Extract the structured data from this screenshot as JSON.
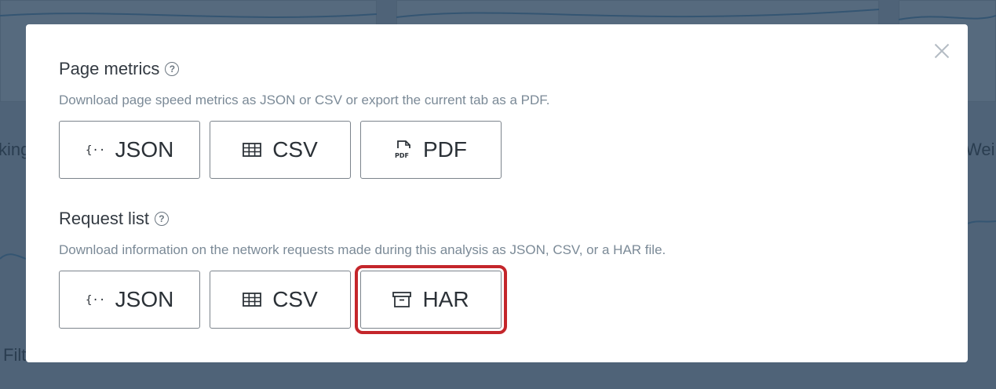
{
  "background": {
    "left_text": "king",
    "right_text": "Wei",
    "bottom_text": "Filt"
  },
  "modal": {
    "page_metrics": {
      "title": "Page metrics",
      "help_icon": "?",
      "description": "Download page speed metrics as JSON or CSV or export the current tab as a PDF.",
      "buttons": [
        {
          "label": "JSON",
          "icon": "json-braces-icon"
        },
        {
          "label": "CSV",
          "icon": "table-grid-icon"
        },
        {
          "label": "PDF",
          "icon": "pdf-file-icon"
        }
      ]
    },
    "request_list": {
      "title": "Request list",
      "help_icon": "?",
      "description": "Download information on the network requests made during this analysis as JSON, CSV, or a HAR file.",
      "buttons": [
        {
          "label": "JSON",
          "icon": "json-braces-icon"
        },
        {
          "label": "CSV",
          "icon": "table-grid-icon"
        },
        {
          "label": "HAR",
          "icon": "archive-box-icon"
        }
      ]
    },
    "highlight_color": "#c4262b"
  }
}
